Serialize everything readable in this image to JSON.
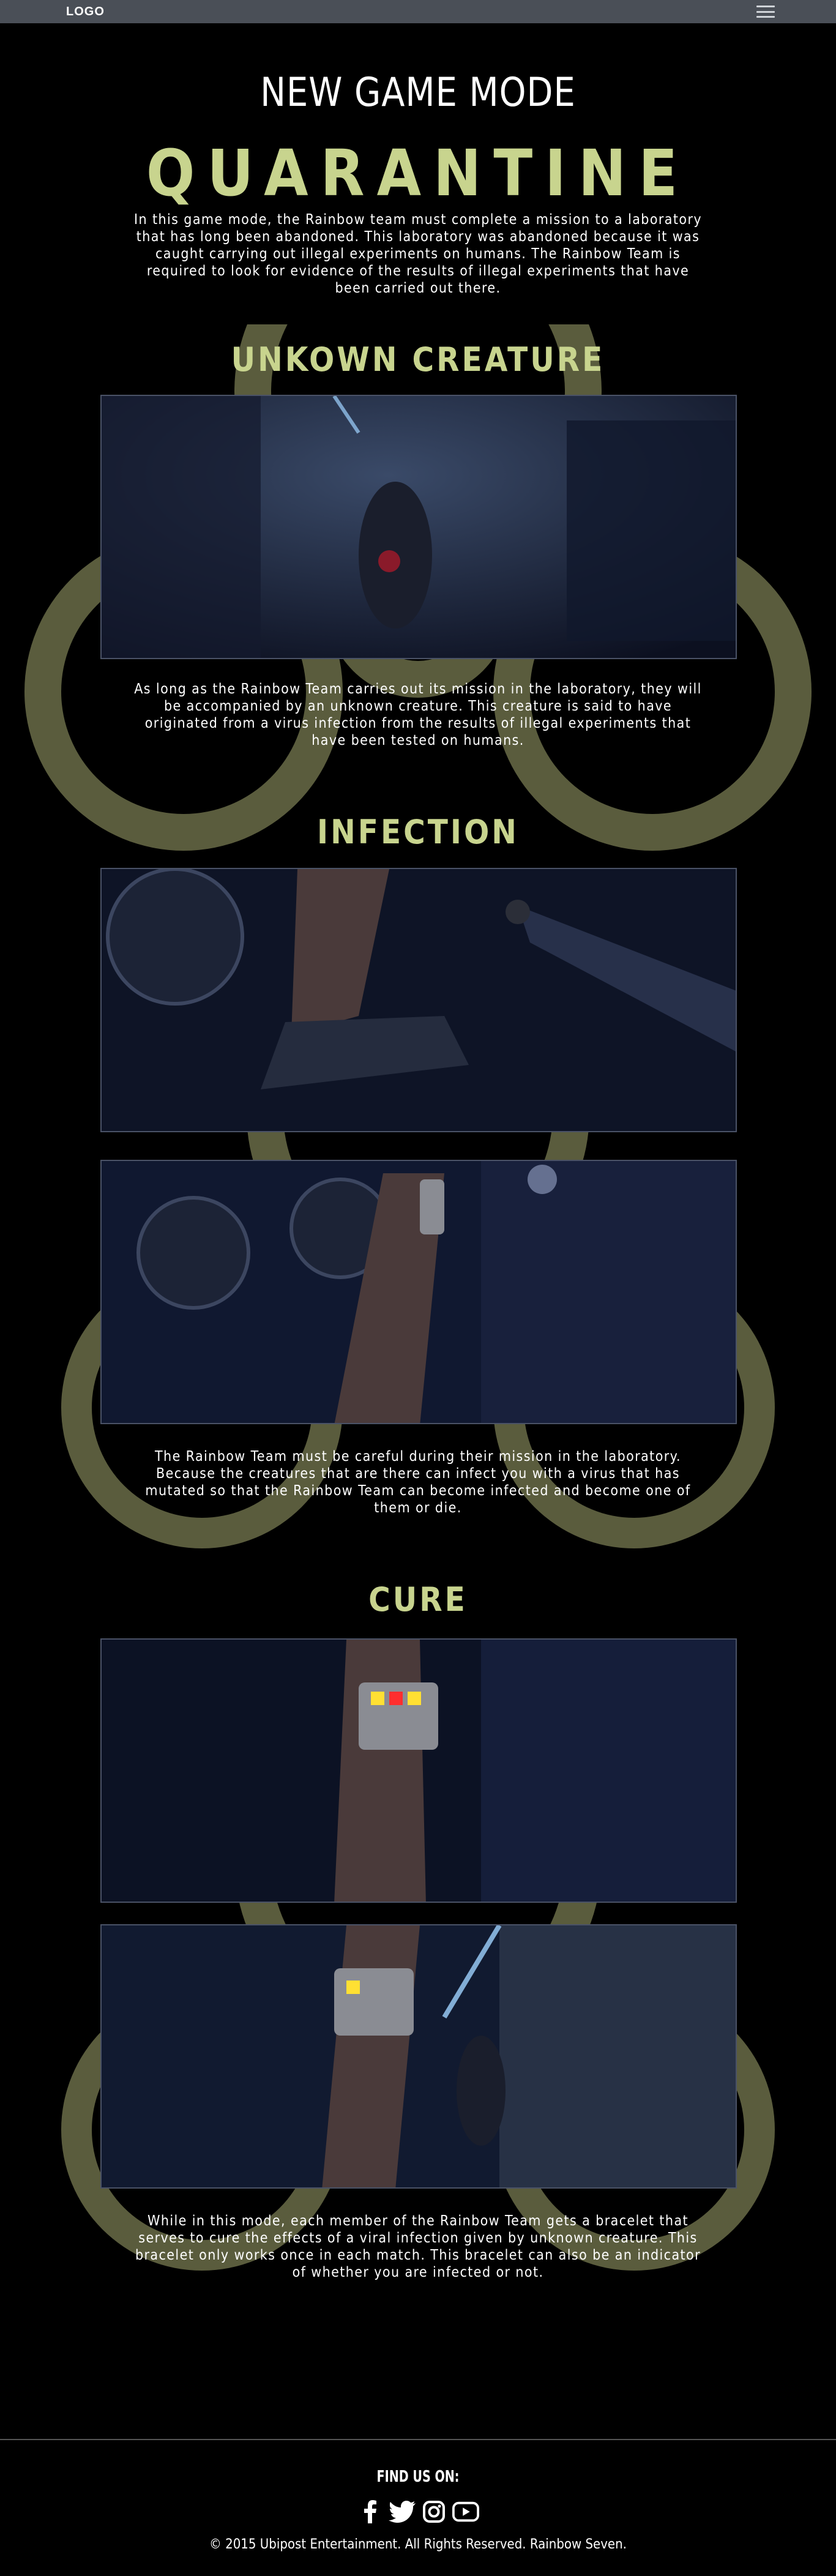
{
  "navbar": {
    "logo_text": "LOGO",
    "menu_icon": "hamburger-menu-icon"
  },
  "hero": {
    "kicker": "NEW GAME MODE",
    "title": "QUARANTINE",
    "intro": "In this game mode, the Rainbow team must complete a mission to a laboratory that has long been abandoned. This laboratory was abandoned because it was caught carrying out illegal experiments on humans. The Rainbow Team is required to look for evidence of the results of illegal experiments that have been carried out there."
  },
  "sections": [
    {
      "title": "UNKOWN CREATURE",
      "text": "As long as the Rainbow Team carries out its mission in the laboratory, they will be accompanied by an unknown creature. This creature is said to have originated from a virus infection from the results of illegal experiments that have been tested on humans."
    },
    {
      "title": "INFECTION",
      "text": "The Rainbow Team must be careful during their mission in the laboratory. Because the creatures that are there can infect you with a virus that has mutated so that the Rainbow Team can become infected and become one of them or die."
    },
    {
      "title": "CURE",
      "text": "While in this mode, each member of the Rainbow Team gets a bracelet that serves to cure the effects of a viral infection given by unknown creature. This bracelet only works once in each match. This bracelet can also be an indicator of whether you are infected or not."
    }
  ],
  "footer": {
    "find_us": "FIND US ON:",
    "social_icons": [
      "facebook-icon",
      "twitter-icon",
      "instagram-icon",
      "youtube-icon"
    ],
    "copyright": "© 2015 Ubipost Entertainment. All Rights Reserved. Rainbow Seven."
  },
  "colors": {
    "accent": "#c8d48e",
    "biohazard": "#5a5c3d",
    "navbar": "#4a4f57",
    "background": "#000000"
  }
}
